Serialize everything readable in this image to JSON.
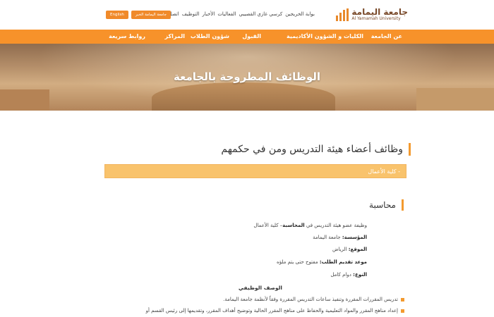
{
  "header": {
    "logo_ar": "جامعة اليمامة",
    "logo_en": "Al Yamamah University",
    "top_links": [
      "بوابة الخريجين",
      "كرسي غازي القصيبي",
      "الفعاليات",
      "الأخبار",
      "التوظيف",
      "اتصل بنا"
    ],
    "top_buttons": [
      "English",
      "جامعة اليمامة الخبر"
    ]
  },
  "nav": {
    "items": [
      "عن الجامعة",
      "الكليات و الشؤون الأكاديمية",
      "القبول",
      "شؤون الطلاب",
      "المراكز",
      "روابط سريعة"
    ]
  },
  "hero": {
    "title": "الوظائف المطروحة بالجامعة"
  },
  "content": {
    "section_title": "وظائف أعضاء هيئة التدريس ومن في حكمهم",
    "accordion_label": "- كلية الأعمال",
    "job_title": "محاسبة",
    "desc_prefix": "وظيفة عضو هيئة التدريس في ",
    "desc_bold": "المحاسبة",
    "desc_suffix": "– كلية الأعمال",
    "org_label": "المؤسسة:",
    "org_value": "جامعة اليمامة",
    "loc_label": "الموقع:",
    "loc_value": "الرياض",
    "deadline_label": "موعد تقديم الطلب:",
    "deadline_value": "مفتوح حتى يتم ملؤه",
    "type_label": "النوع:",
    "type_value": "دوام كامل",
    "duties_heading": "الوصف الوظيفي",
    "bullets": [
      "تدريس المقررات المقررة وتنفيذ ساعات التدريس المقررة وفقاً لأنظمة جامعة اليمامة.",
      "إعداد مناهج المقرر والمواد التعليمية والحفاظ على مناهج المقرر الحالية وتوضيح أهداف المقرر، وتقديمها إلى رئيس القسم أو"
    ]
  },
  "colors": {
    "accent": "#f7922a",
    "accordion": "#f9c36c",
    "bullet": "#f39a2f"
  }
}
